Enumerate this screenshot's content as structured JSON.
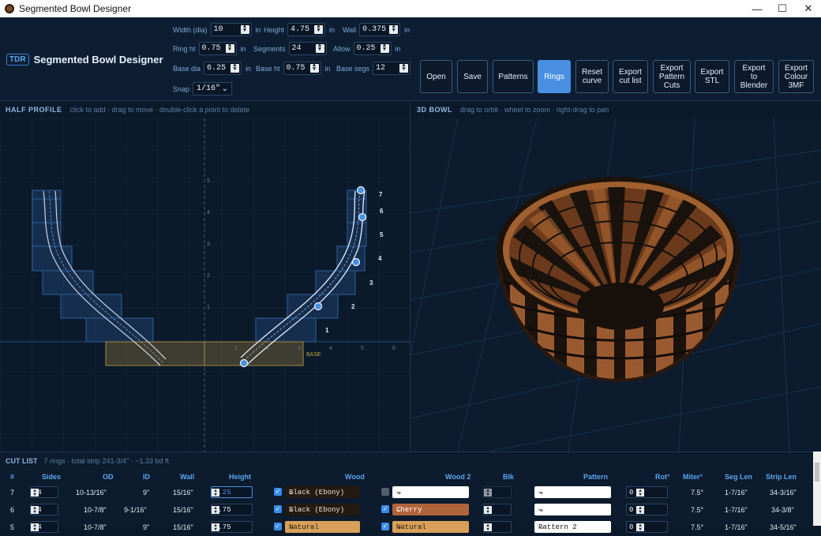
{
  "window": {
    "title": "Segmented Bowl Designer",
    "minimize": "—",
    "maximize": "☐",
    "close": "✕"
  },
  "brand": {
    "badge": "TDR",
    "name": "Segmented Bowl Designer"
  },
  "params": {
    "width": {
      "label": "Width (dia)",
      "value": "10",
      "unit": "in"
    },
    "height": {
      "label": "Height",
      "value": "4.75",
      "unit": "in"
    },
    "wall": {
      "label": "Wall",
      "value": "0.375",
      "unit": "in"
    },
    "ring_ht": {
      "label": "Ring ht",
      "value": "0.75",
      "unit": "in"
    },
    "segments": {
      "label": "Segments",
      "value": "24"
    },
    "allow": {
      "label": "Allow",
      "value": "0.25",
      "unit": "in"
    },
    "base_dia": {
      "label": "Base dia",
      "value": "6.25",
      "unit": "in"
    },
    "base_ht": {
      "label": "Base ht",
      "value": "0.75",
      "unit": "in"
    },
    "base_segs": {
      "label": "Base segs",
      "value": "12"
    },
    "snap": {
      "label": "Snap",
      "value": "1/16\""
    }
  },
  "buttons": {
    "open": "Open",
    "save": "Save",
    "patterns": "Patterns",
    "rings": "Rings",
    "reset_l1": "Reset",
    "reset_l2": "curve",
    "cut_l1": "Export",
    "cut_l2": "cut list",
    "pat_l1": "Export",
    "pat_l2": "Pattern",
    "pat_l3": "Cuts",
    "stl_l1": "Export",
    "stl_l2": "STL",
    "bl_l1": "Export",
    "bl_l2": "to",
    "bl_l3": "Blender",
    "c3_l1": "Export",
    "c3_l2": "Colour",
    "c3_l3": "3MF"
  },
  "half_profile": {
    "title": "HALF PROFILE",
    "hint": "click to add · drag to move · double-click a point to delete",
    "x_ticks": [
      "1",
      "2",
      "3",
      "4",
      "5",
      "6"
    ],
    "y_ticks": [
      "1",
      "2",
      "3",
      "4",
      "5"
    ],
    "ring_labels": [
      "1",
      "2",
      "3",
      "4",
      "5",
      "6",
      "7"
    ],
    "base_label": "BASE"
  },
  "bowl_3d": {
    "title": "3D BOWL",
    "hint": "drag to orbit · wheel to zoom · right-drag to pan"
  },
  "cut_list": {
    "title": "CUT LIST",
    "summary": "7 rings · total strip 241-3/4\" · ~1.33 bd ft",
    "columns": [
      "#",
      "Sides",
      "OD",
      "ID",
      "Wall",
      "Height",
      "Wood",
      "Wood 2",
      "Blk",
      "Pattern",
      "Rot°",
      "Miter°",
      "Seg Len",
      "Strip Len"
    ],
    "rows": [
      {
        "n": "7",
        "sides": "24",
        "od": "10-13/16\"",
        "id": "9\"",
        "wall": "15/16\"",
        "height": "0.25",
        "wood": "Black (Ebony)",
        "wood2": "—",
        "blk": "1",
        "pattern": "—",
        "rot": "0",
        "miter": "7.5°",
        "seg": "1-7/16\"",
        "strip": "34-3/16\""
      },
      {
        "n": "6",
        "sides": "24",
        "od": "10-7/8\"",
        "id": "9-1/16\"",
        "wall": "15/16\"",
        "height": "0.75",
        "wood": "Black (Ebony)",
        "wood2": "Cherry",
        "blk": "1",
        "pattern": "—",
        "rot": "0",
        "miter": "7.5°",
        "seg": "1-7/16\"",
        "strip": "34-3/8\""
      },
      {
        "n": "5",
        "sides": "24",
        "od": "10-7/8\"",
        "id": "9\"",
        "wall": "15/16\"",
        "height": "0.75",
        "wood": "Natural",
        "wood2": "Natural",
        "blk": "1",
        "pattern": "Pattern 2",
        "rot": "0",
        "miter": "7.5°",
        "seg": "1-7/16\"",
        "strip": "34-5/16\""
      }
    ]
  },
  "colors": {
    "accent": "#4a90e2",
    "ebony": "#241a14",
    "cherry": "#b0643a",
    "natural": "#d8a05a"
  }
}
